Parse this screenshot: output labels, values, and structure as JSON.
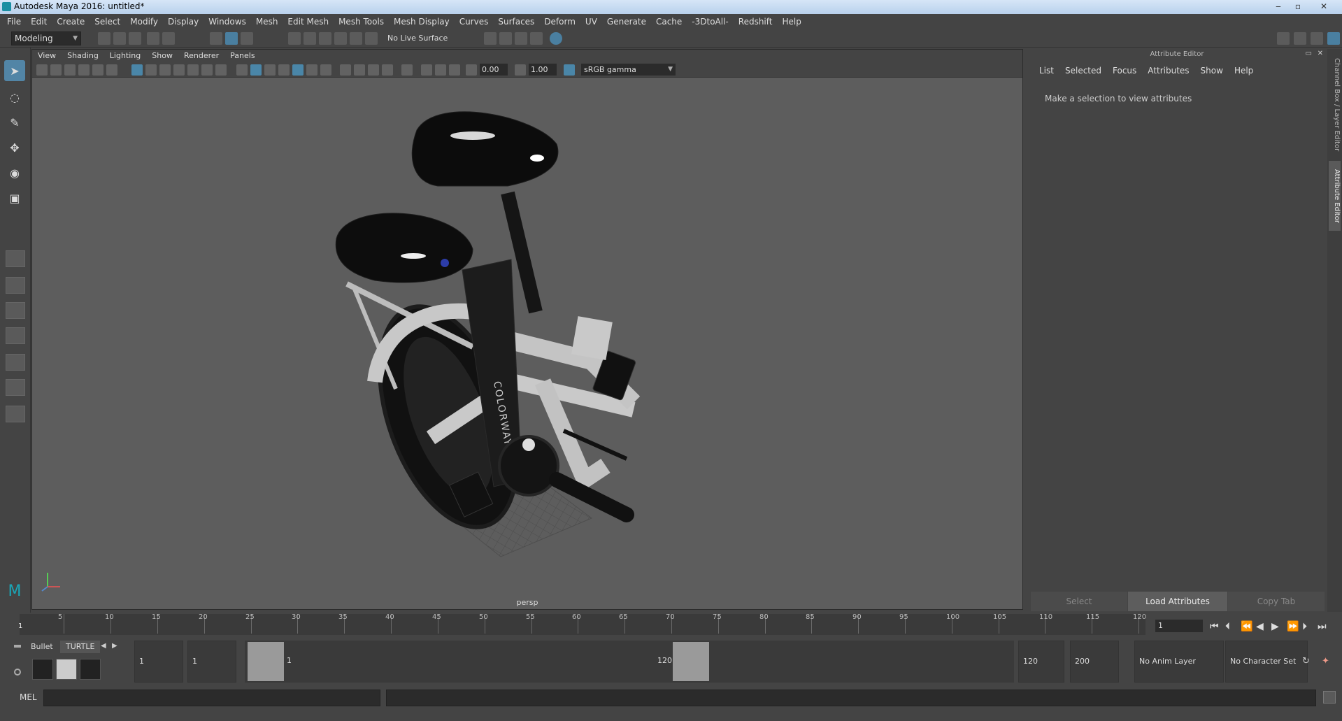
{
  "window": {
    "title": "Autodesk Maya 2016: untitled*"
  },
  "menubar": [
    "File",
    "Edit",
    "Create",
    "Select",
    "Modify",
    "Display",
    "Windows",
    "Mesh",
    "Edit Mesh",
    "Mesh Tools",
    "Mesh Display",
    "Curves",
    "Surfaces",
    "Deform",
    "UV",
    "Generate",
    "Cache",
    "-3DtoAll-",
    "Redshift",
    "Help"
  ],
  "statusline": {
    "mode": "Modeling",
    "live_surface": "No Live Surface"
  },
  "viewport": {
    "menu": [
      "View",
      "Shading",
      "Lighting",
      "Show",
      "Renderer",
      "Panels"
    ],
    "near_value": "0.00",
    "far_value": "1.00",
    "color_space": "sRGB gamma",
    "camera_label": "persp",
    "model_name": "COLORWAY"
  },
  "attribute_editor": {
    "header": "Attribute Editor",
    "menu": [
      "List",
      "Selected",
      "Focus",
      "Attributes",
      "Show",
      "Help"
    ],
    "message": "Make a selection to view attributes",
    "buttons": [
      "Select",
      "Load Attributes",
      "Copy Tab"
    ]
  },
  "side_tabs": [
    "Channel Box / Layer Editor",
    "Attribute Editor"
  ],
  "timeline": {
    "start_label": "1",
    "ticks": [
      "5",
      "10",
      "15",
      "20",
      "25",
      "30",
      "35",
      "40",
      "45",
      "50",
      "55",
      "60",
      "65",
      "70",
      "75",
      "80",
      "85",
      "90",
      "95",
      "100",
      "105",
      "110",
      "115",
      "120"
    ],
    "current_frame": "1"
  },
  "range": {
    "shelf_tabs": [
      "Bullet",
      "TURTLE"
    ],
    "start_anim": "1",
    "start_play": "1",
    "range_start": "1",
    "range_end": "120",
    "end_play": "120",
    "end_anim": "200",
    "anim_layer": "No Anim Layer",
    "character_set": "No Character Set"
  },
  "command_line": {
    "label": "MEL"
  }
}
